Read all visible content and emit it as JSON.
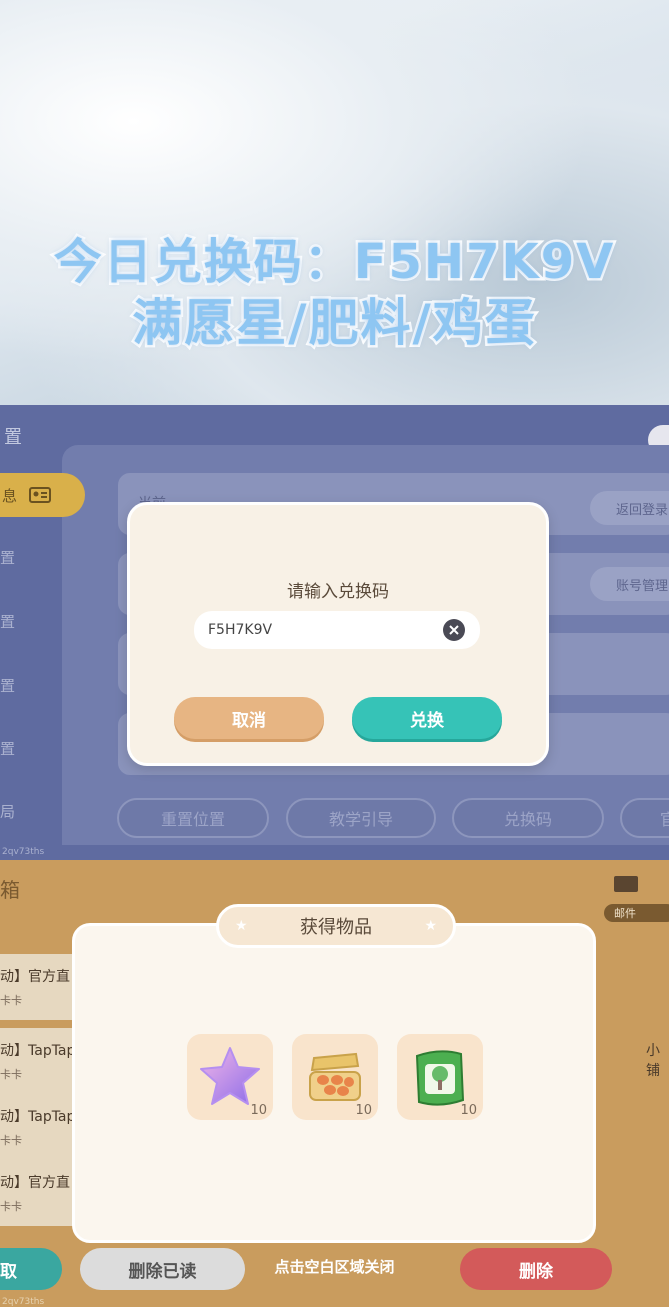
{
  "banner": {
    "line1": "今日兑换码：F5H7K9V",
    "line2": "满愿星/肥料/鸡蛋"
  },
  "settings_bg": {
    "title_fragment": "置",
    "sidebar_active": "息",
    "sidebar_items": [
      "置",
      "置",
      "置",
      "置",
      "局"
    ],
    "right_buttons": [
      "返回登录",
      "账号管理"
    ],
    "row_text_fragment": "当前",
    "bottom_buttons": [
      "重置位置",
      "教学引导",
      "兑换码",
      "官"
    ],
    "version_fragment": "2qv73ths"
  },
  "redeem_dialog": {
    "title": "请输入兑换码",
    "input_value": "F5H7K9V",
    "cancel_label": "取消",
    "confirm_label": "兑换"
  },
  "mail_bg": {
    "title_fragment": "箱",
    "tab_label": "邮件",
    "items": [
      {
        "title": "动】官方直",
        "sub": "卡卡"
      },
      {
        "title": "动】TapTap",
        "sub": "卡卡"
      },
      {
        "title": "动】TapTap",
        "sub": "卡卡"
      },
      {
        "title": "动】官方直",
        "sub": "卡卡"
      }
    ],
    "right_fragment": "小铺",
    "left_button": "取",
    "delete_read_label": "删除已读",
    "delete_label": "删除",
    "version_fragment": "2qv73ths"
  },
  "reward_popup": {
    "title": "获得物品",
    "items": [
      {
        "icon": "purple-star-icon",
        "count": "10"
      },
      {
        "icon": "egg-carton-icon",
        "count": "10"
      },
      {
        "icon": "fertilizer-bag-icon",
        "count": "10"
      }
    ],
    "close_hint": "点击空白区域关闭"
  }
}
